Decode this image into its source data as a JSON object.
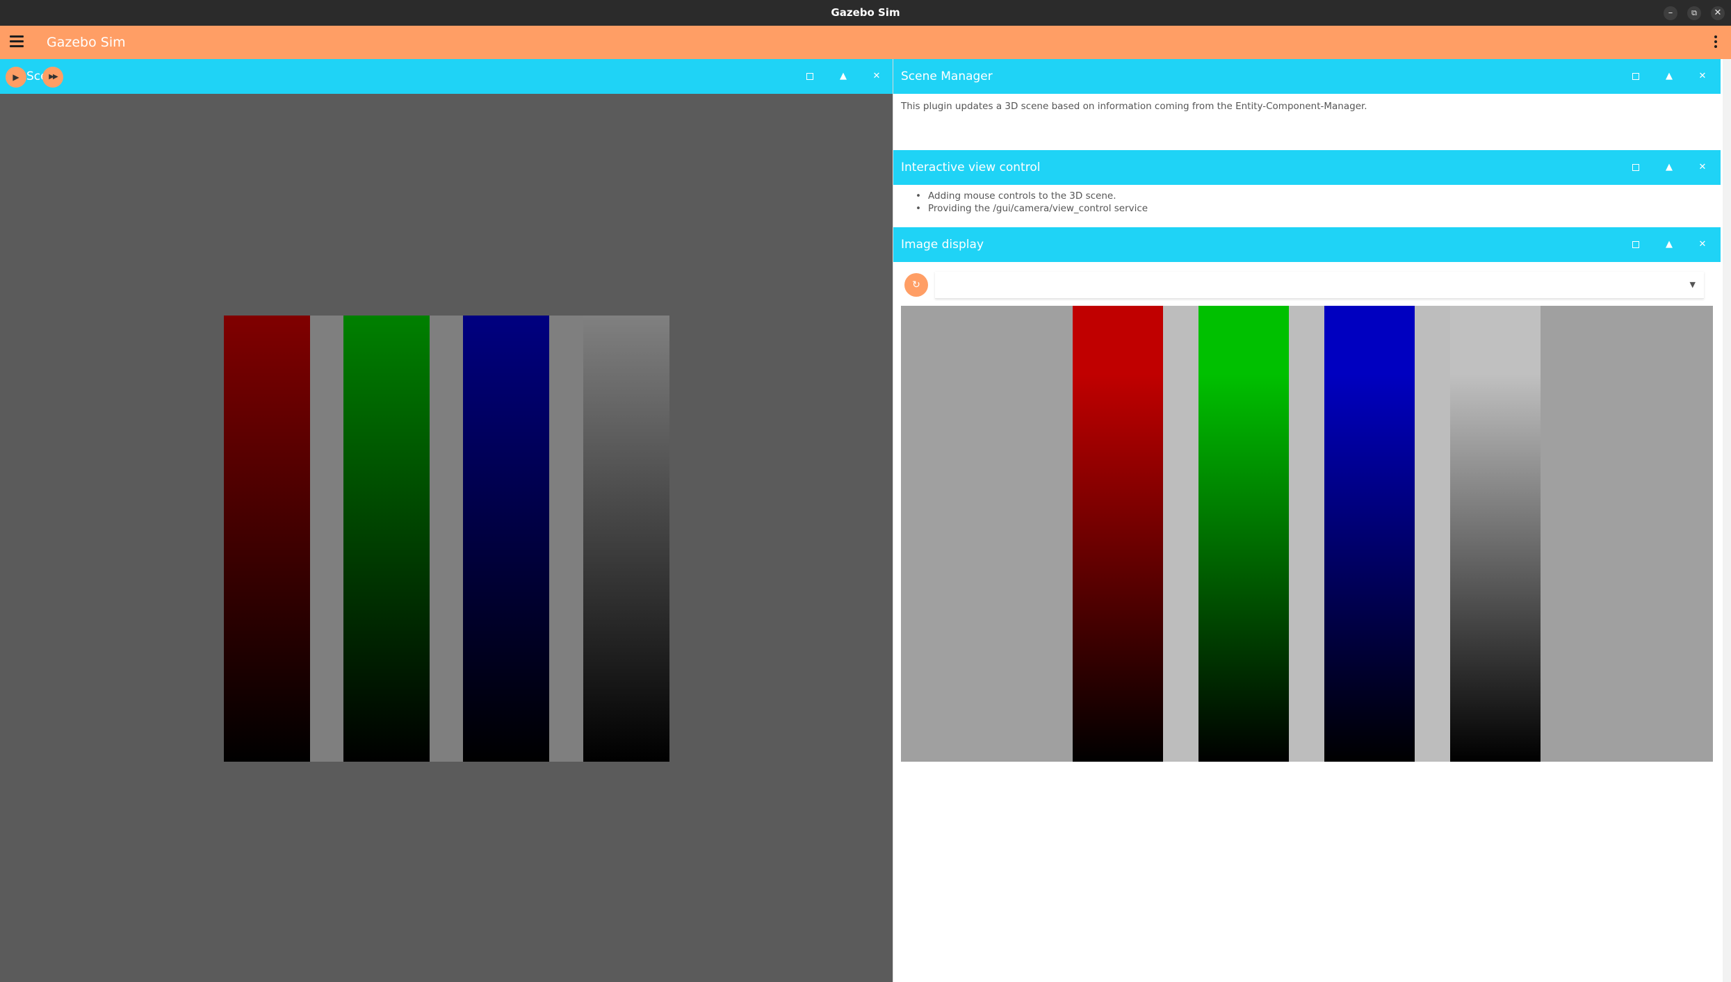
{
  "window": {
    "title": "Gazebo Sim",
    "minimize_glyph": "–",
    "restore_glyph": "⧉",
    "close_glyph": "✕"
  },
  "appbar": {
    "title": "Gazebo Sim",
    "menu_icon": "hamburger-menu-icon",
    "overflow_icon": "kebab-menu-icon"
  },
  "scene_panel": {
    "title": "Scene3D",
    "title_visible": "Sce",
    "play_glyph": "▶",
    "step_glyph": "▶▶",
    "max_glyph": "",
    "collapse_glyph": "▲",
    "close_glyph": "✕",
    "background": "#5b5b5b",
    "bars": [
      {
        "name": "red",
        "color": "#800000"
      },
      {
        "name": "green",
        "color": "#008000"
      },
      {
        "name": "blue",
        "color": "#000080"
      },
      {
        "name": "gray",
        "color": "#808080"
      }
    ]
  },
  "scene_manager": {
    "title": "Scene Manager",
    "description": "This plugin updates a 3D scene based on information coming from the Entity-Component-Manager.",
    "collapse_glyph": "▲",
    "close_glyph": "✕"
  },
  "view_control": {
    "title": "Interactive view control",
    "bullets": [
      "Adding mouse controls to the 3D scene.",
      "Providing the /gui/camera/view_control service"
    ],
    "collapse_glyph": "▲",
    "close_glyph": "✕"
  },
  "image_display": {
    "title": "Image display",
    "refresh_glyph": "↻",
    "topic_value": "",
    "dropdown_glyph": "▼",
    "collapse_glyph": "▲",
    "close_glyph": "✕",
    "bars": [
      {
        "name": "red",
        "color": "#c00000"
      },
      {
        "name": "green",
        "color": "#00c000"
      },
      {
        "name": "blue",
        "color": "#0000c0"
      },
      {
        "name": "gray",
        "color": "#c0c0c0"
      }
    ]
  },
  "colors": {
    "titlebar": "#2b2b2b",
    "appbar": "#ff9e65",
    "panel_header": "#1fd3f6",
    "accent": "#ff9e65"
  }
}
